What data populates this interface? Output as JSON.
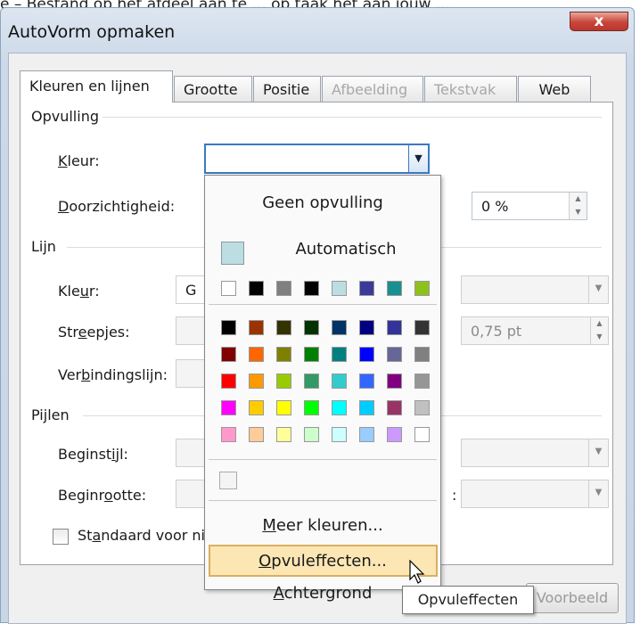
{
  "caption_strip": "e – Bestand op het afdeel aan te  ... op taak het aan jouw ...",
  "window": {
    "title": "AutoVorm opmaken",
    "close_glyph": "x"
  },
  "tabs": [
    {
      "label": "Kleuren en lijnen",
      "state": "active"
    },
    {
      "label": "Grootte",
      "state": "normal"
    },
    {
      "label": "Positie",
      "state": "normal"
    },
    {
      "label": "Afbeelding",
      "state": "disabled"
    },
    {
      "label": "Tekstvak",
      "state": "disabled"
    },
    {
      "label": "Web",
      "state": "normal"
    }
  ],
  "fill": {
    "group": "Opvulling",
    "color_label_pre": "",
    "color_label_u": "K",
    "color_label_post": "leur:",
    "transparency_label_u": "D",
    "transparency_label_post": "oorzichtigheid:",
    "transparency_value": "0 %"
  },
  "line": {
    "group": "Lijn",
    "color_label_pre": "Kle",
    "color_label_u": "u",
    "color_label_post": "r:",
    "color_value_partial": "G",
    "dashes_label_pre": "Str",
    "dashes_label_u": "e",
    "dashes_label_post": "epjes:",
    "weight_value": "0,75 pt",
    "connector_label_pre": "Ver",
    "connector_label_u": "b",
    "connector_label_post": "indingslijn:"
  },
  "arrows": {
    "group": "Pijlen",
    "begin_style_pre": "Beginst",
    "begin_style_u": "i",
    "begin_style_post": "jl:",
    "begin_size_pre": "Beginr",
    "begin_size_u": "o",
    "begin_size_post": "otte:",
    "begin_size_trailing": ":"
  },
  "default_checkbox": {
    "pre": "St",
    "u": "a",
    "post": "ndaard voor ni"
  },
  "bottom": {
    "preview_button": "Voorbeeld"
  },
  "popup": {
    "no_fill": "Geen opvulling",
    "automatic": "Automatisch",
    "more_colors_pre": "",
    "more_colors_u": "M",
    "more_colors_post": "eer kleuren...",
    "fill_effects_pre": "",
    "fill_effects_u": "O",
    "fill_effects_post": "pvuleffecten...",
    "background_pre": "",
    "background_u": "A",
    "background_post": "chtergrond",
    "theme_row": [
      "#ffffff",
      "#000000",
      "#808080",
      "#000000",
      "#bcdde2",
      "#3a3a9a",
      "#1a8f8f",
      "#8dc21e"
    ],
    "standard_grid": [
      [
        "#000000",
        "#993300",
        "#333300",
        "#003300",
        "#003366",
        "#000080",
        "#333399",
        "#333333"
      ],
      [
        "#800000",
        "#ff6600",
        "#808000",
        "#008000",
        "#008080",
        "#0000ff",
        "#666699",
        "#808080"
      ],
      [
        "#ff0000",
        "#ff9900",
        "#99cc00",
        "#339966",
        "#33cccc",
        "#3366ff",
        "#800080",
        "#969696"
      ],
      [
        "#ff00ff",
        "#ffcc00",
        "#ffff00",
        "#00ff00",
        "#00ffff",
        "#00ccff",
        "#993366",
        "#c0c0c0"
      ],
      [
        "#ff99cc",
        "#ffcc99",
        "#ffff99",
        "#ccffcc",
        "#ccffff",
        "#99ccff",
        "#cc99ff",
        "#ffffff"
      ]
    ]
  },
  "tooltip": "Opvuleffecten",
  "colors": {
    "accent_border": "#3a78c2",
    "highlight_fill": "#fbe6b4",
    "highlight_border": "#d9b060"
  }
}
